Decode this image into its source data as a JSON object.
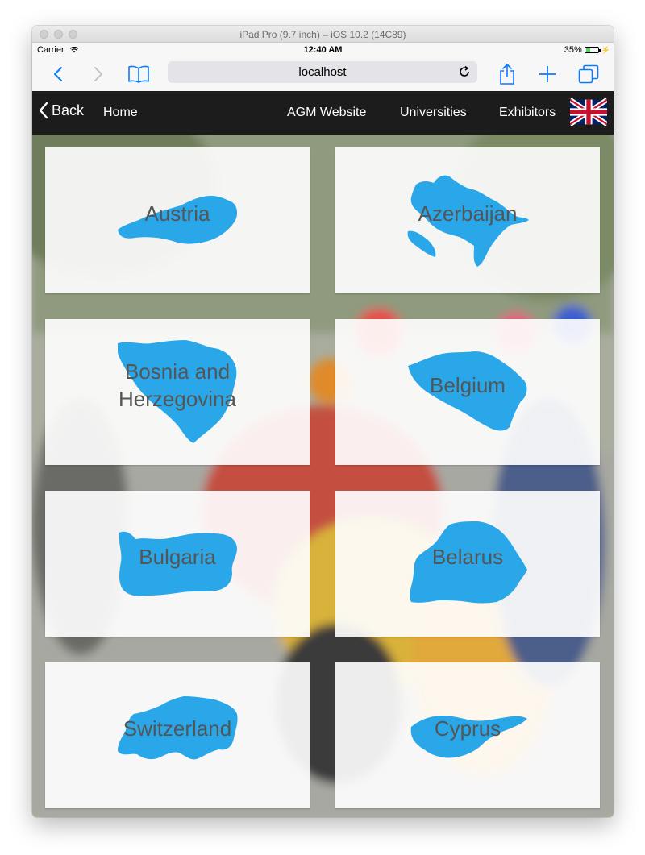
{
  "window": {
    "title": "iPad Pro (9.7 inch) – iOS 10.2 (14C89)"
  },
  "status_bar": {
    "carrier": "Carrier",
    "time": "12:40 AM",
    "battery": "35%"
  },
  "browser": {
    "url": "localhost"
  },
  "nav": {
    "back_label": "Back",
    "home_label": "Home",
    "agm_label": "AGM Website",
    "universities_label": "Universities",
    "exhibitors_label": "Exhibitors"
  },
  "countries": [
    {
      "name": "Austria"
    },
    {
      "name": "Azerbaijan"
    },
    {
      "name": "Bosnia and Herzegovina"
    },
    {
      "name": "Belgium"
    },
    {
      "name": "Bulgaria"
    },
    {
      "name": "Belarus"
    },
    {
      "name": "Switzerland"
    },
    {
      "name": "Cyprus"
    }
  ],
  "colors": {
    "map_shape": "#2aa7e8",
    "navbar": "#1c1c1c",
    "ios_blue": "#0a7aff"
  }
}
